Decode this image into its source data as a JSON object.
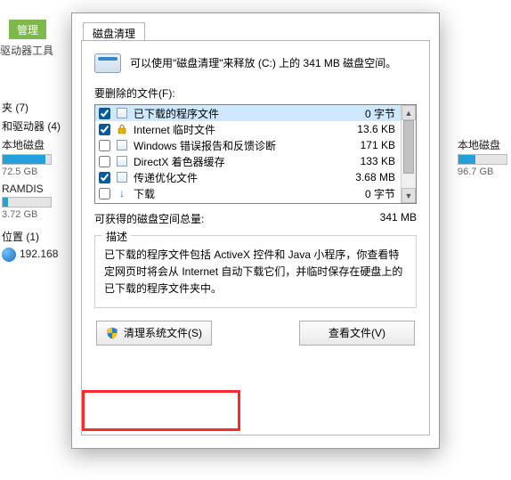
{
  "bg": {
    "tab1": "管理",
    "tab2": "驱动器工具",
    "left_cat1": "夹 (7)",
    "left_cat2": "和驱动器 (4)",
    "drive1_name": "本地磁盘",
    "drive1_cap": "72.5 GB",
    "drive1_fill_pct": 88,
    "drive2_name": "RAMDIS",
    "drive2_cap": "3.72 GB",
    "drive2_fill_pct": 12,
    "loc_label": "位置 (1)",
    "net_label": "192.168",
    "right_drive_name": "本地磁盘",
    "right_drive_cap": "96.7 GB",
    "right_drive_fill_pct": 35
  },
  "dlg": {
    "tab": "磁盘清理",
    "info": "可以使用\"磁盘清理\"来释放  (C:) 上的 341 MB 磁盘空间。",
    "files_label": "要删除的文件(F):",
    "items": [
      {
        "checked": true,
        "icon": "generic",
        "name": "已下载的程序文件",
        "size": "0 字节",
        "selected": true
      },
      {
        "checked": true,
        "icon": "lock",
        "name": "Internet 临时文件",
        "size": "13.6 KB",
        "selected": false
      },
      {
        "checked": false,
        "icon": "generic",
        "name": "Windows 错误报告和反馈诊断",
        "size": "171 KB",
        "selected": false
      },
      {
        "checked": false,
        "icon": "generic",
        "name": "DirectX 着色器缓存",
        "size": "133 KB",
        "selected": false
      },
      {
        "checked": true,
        "icon": "generic",
        "name": "传递优化文件",
        "size": "3.68 MB",
        "selected": false
      },
      {
        "checked": false,
        "icon": "dl",
        "name": "下载",
        "size": "0 字节",
        "selected": false
      }
    ],
    "total_label": "可获得的磁盘空间总量:",
    "total_value": "341 MB",
    "desc_legend": "描述",
    "desc_text": "已下载的程序文件包括 ActiveX 控件和 Java 小程序，你查看特定网页时将会从 Internet 自动下载它们，并临时保存在硬盘上的已下载的程序文件夹中。",
    "btn_cleanup": "清理系统文件(S)",
    "btn_view": "查看文件(V)"
  }
}
